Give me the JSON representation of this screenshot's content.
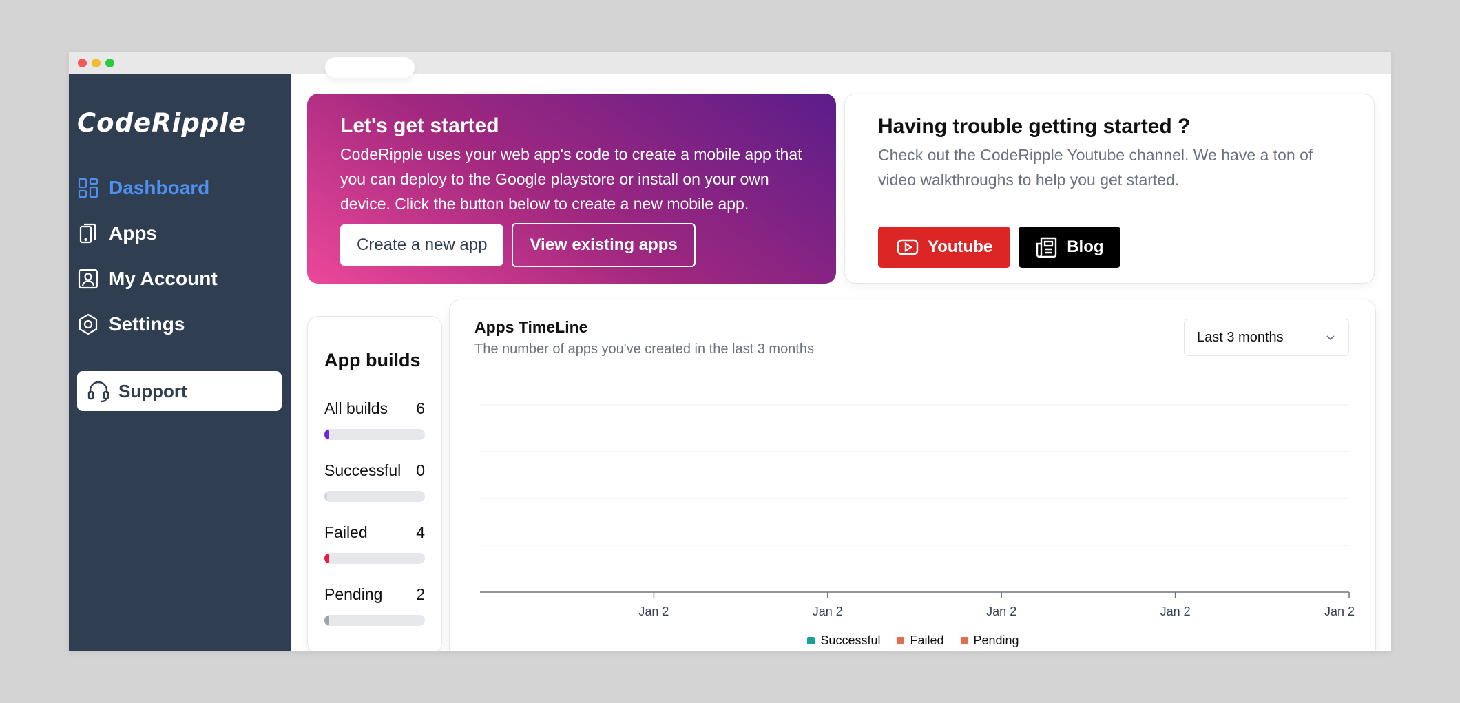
{
  "app": {
    "logo": "CodeRipple"
  },
  "sidebar": {
    "items": [
      {
        "label": "Dashboard",
        "icon": "dashboard-icon",
        "active": true
      },
      {
        "label": "Apps",
        "icon": "phone-icon"
      },
      {
        "label": "My Account",
        "icon": "account-icon"
      },
      {
        "label": "Settings",
        "icon": "settings-icon"
      }
    ],
    "support_label": "Support"
  },
  "hero": {
    "title": "Let's get started",
    "text": "CodeRipple uses your web app's code to create a mobile app that you can deploy to the Google playstore or install on your own device. Click the button below to create a new mobile app.",
    "primary_label": "Create a new app",
    "secondary_label": "View existing apps"
  },
  "help": {
    "title": "Having trouble getting started ?",
    "text": "Check out the CodeRipple Youtube channel. We have a ton of video walkthroughs to help you get started.",
    "youtube_label": "Youtube",
    "blog_label": "Blog"
  },
  "builds": {
    "title": "App builds",
    "rows": [
      {
        "label": "All builds",
        "count": "6",
        "fraction": 0.04,
        "color": "#6d28d9"
      },
      {
        "label": "Successful",
        "count": "0",
        "fraction": 0,
        "color": "#14b8a6"
      },
      {
        "label": "Failed",
        "count": "4",
        "fraction": 0.03,
        "color": "#e11d48"
      },
      {
        "label": "Pending",
        "count": "2",
        "fraction": 0.01,
        "color": "#9ca3af"
      }
    ]
  },
  "timeline": {
    "title": "Apps TimeLine",
    "subtitle": "The number of apps you've created in the last 3 months",
    "range_selected": "Last 3 months"
  },
  "chart_data": {
    "type": "line",
    "x": [
      "Jan 2",
      "Jan 2",
      "Jan 2",
      "Jan 2",
      "Jan 2"
    ],
    "series": [
      {
        "name": "Successful",
        "values": [],
        "color": "#14a394"
      },
      {
        "name": "Failed",
        "values": [],
        "color": "#e36b4f"
      },
      {
        "name": "Pending",
        "values": [],
        "color": "#e36b4f"
      }
    ],
    "grid": true,
    "legend": "bottom-center"
  }
}
